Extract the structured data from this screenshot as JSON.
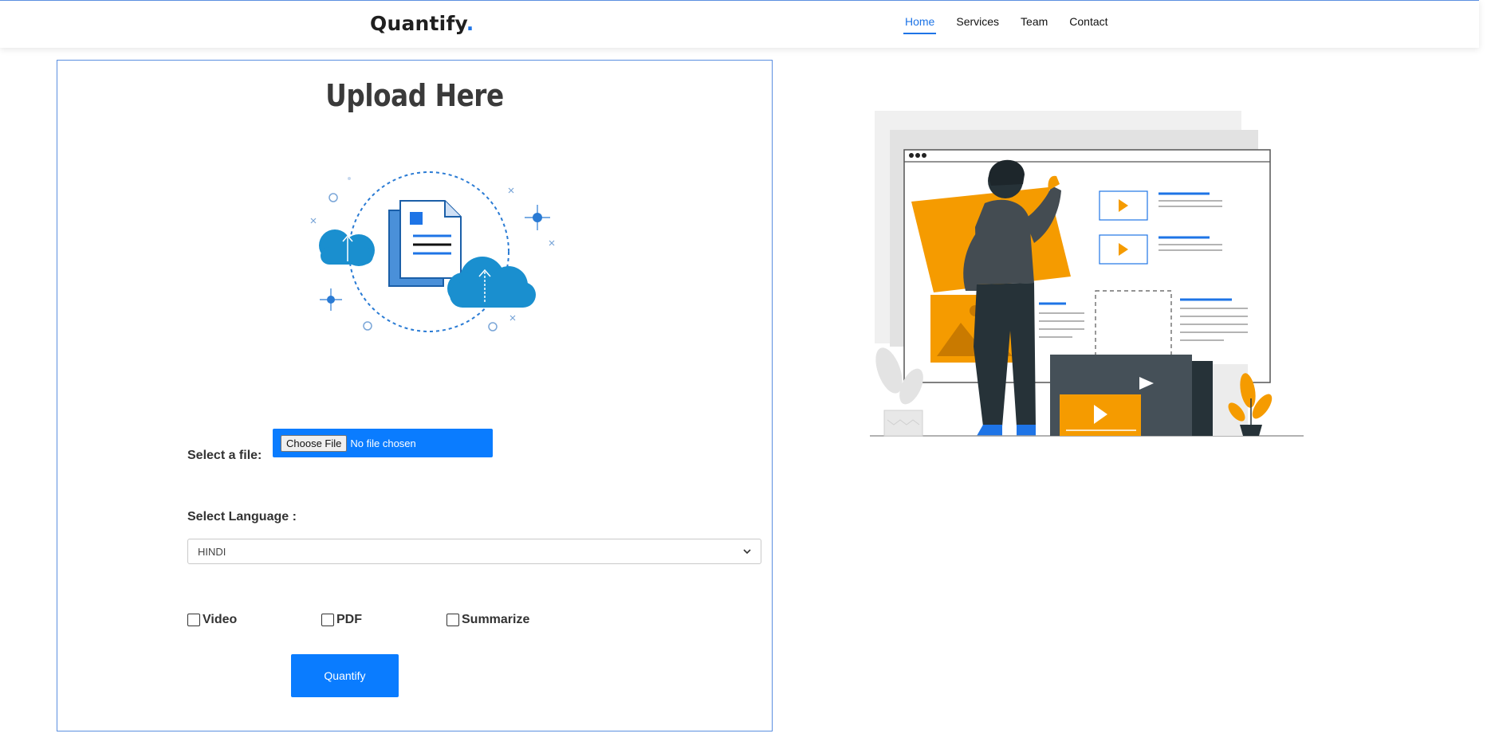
{
  "header": {
    "brand": "Quantify",
    "brand_dot": ".",
    "nav": [
      {
        "label": "Home",
        "active": true
      },
      {
        "label": "Services",
        "active": false
      },
      {
        "label": "Team",
        "active": false
      },
      {
        "label": "Contact",
        "active": false
      }
    ]
  },
  "upload": {
    "title": "Upload Here",
    "file_label": "Select a file:",
    "choose_button": "Choose File",
    "file_status": "No file chosen",
    "language_label": "Select Language :",
    "language_selected": "HINDI",
    "options": [
      {
        "label": "Video",
        "checked": false
      },
      {
        "label": "PDF",
        "checked": false
      },
      {
        "label": "Summarize",
        "checked": false
      }
    ],
    "submit_label": "Quantify"
  },
  "colors": {
    "accent": "#0a7cff",
    "brand_dot": "#1e74e6",
    "panel_border": "#5b8fe0",
    "illustration_orange": "#f59b00",
    "illustration_dark": "#2b3439"
  },
  "icons": {
    "upload_illustration": "cloud-upload-document-icon",
    "hero_illustration": "person-building-webpage-illustration",
    "select_chevron": "chevron-down-icon"
  }
}
